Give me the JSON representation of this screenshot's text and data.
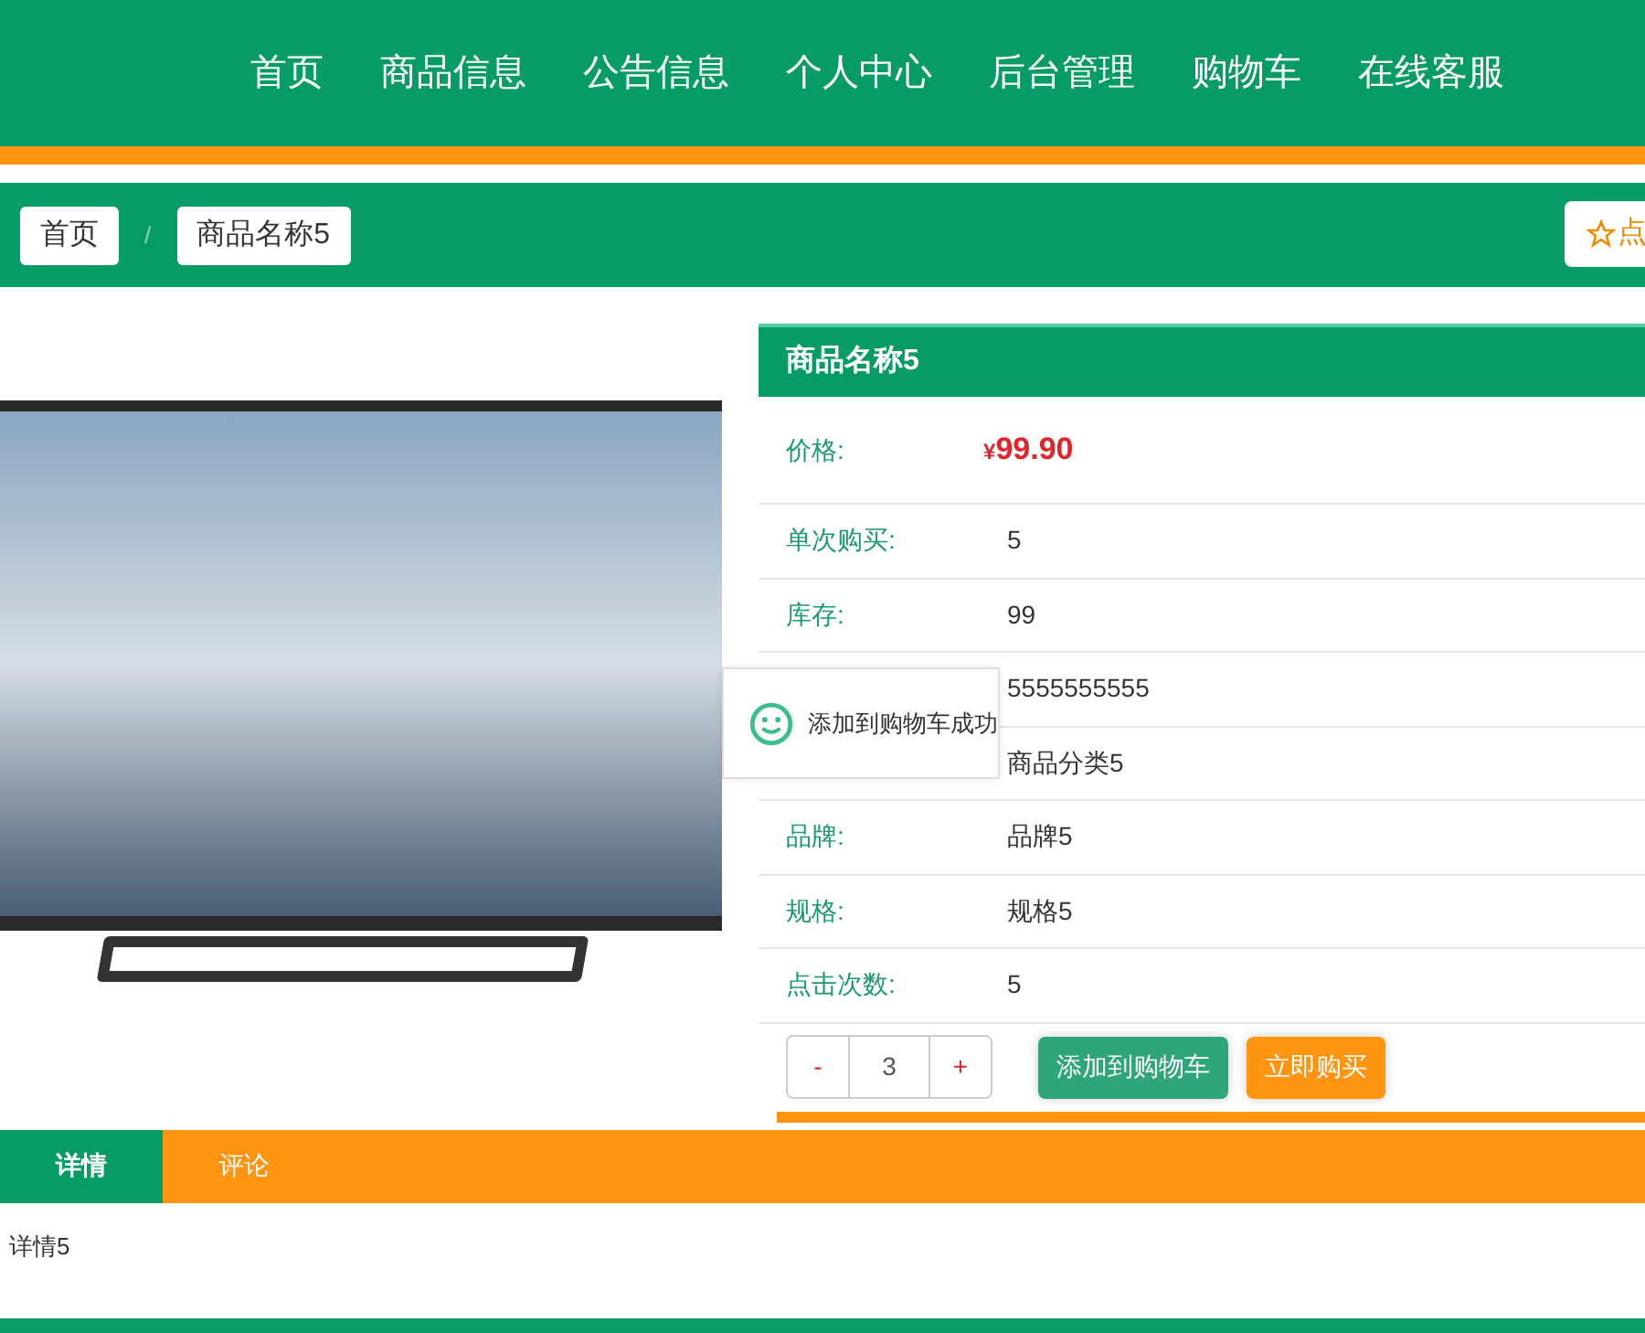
{
  "nav": {
    "items": [
      {
        "label": "首页"
      },
      {
        "label": "商品信息"
      },
      {
        "label": "公告信息"
      },
      {
        "label": "个人中心"
      },
      {
        "label": "后台管理"
      },
      {
        "label": "购物车"
      },
      {
        "label": "在线客服"
      }
    ]
  },
  "breadcrumb": {
    "items": [
      {
        "label": "首页",
        "kind": "box"
      },
      {
        "label": "/",
        "kind": "sep"
      },
      {
        "label": "商品名称5",
        "kind": "box"
      }
    ],
    "favorite_button": "点"
  },
  "product": {
    "title": "商品名称5",
    "price_label": "价格:",
    "currency": "¥",
    "price": "99.90",
    "rows": [
      {
        "label": "单次购买:",
        "value": "5"
      },
      {
        "label": "库存:",
        "value": "99"
      },
      {
        "value": "5555555555"
      },
      {
        "value": "商品分类5"
      },
      {
        "label": "品牌:",
        "value": "品牌5"
      },
      {
        "label": "规格:",
        "value": "规格5"
      },
      {
        "label": "点击次数:",
        "value": "5"
      }
    ],
    "quantity": {
      "minus": "-",
      "value": "3",
      "plus": "+"
    },
    "buttons": [
      {
        "label": "添加到购物车",
        "kind": "cart"
      },
      {
        "label": "立即购买",
        "kind": "buy"
      }
    ]
  },
  "toast": {
    "message": "添加到购物车成功"
  },
  "tabs": [
    {
      "label": "详情",
      "selected": true
    },
    {
      "label": "评论",
      "selected": false
    }
  ],
  "detail": "详情5"
}
